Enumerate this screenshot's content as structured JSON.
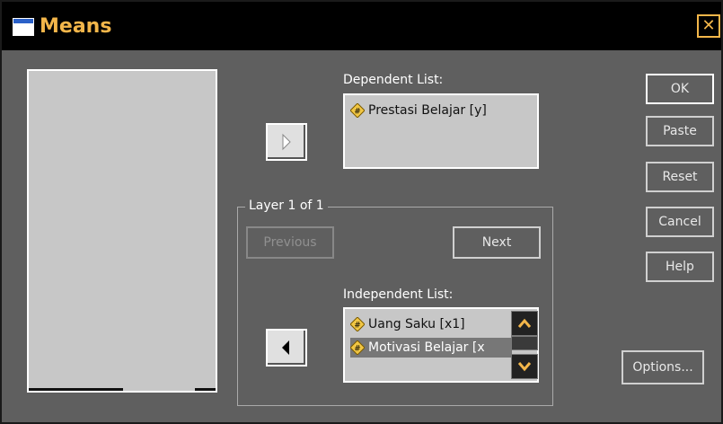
{
  "window": {
    "title": "Means"
  },
  "variables": [],
  "dependent": {
    "label": "Dependent List:",
    "items": [
      {
        "label": "Prestasi Belajar [y]",
        "icon": "scale-variable-icon"
      }
    ]
  },
  "layer": {
    "legend": "Layer 1 of 1",
    "previous_label": "Previous",
    "next_label": "Next"
  },
  "independent": {
    "label": "Independent List:",
    "items": [
      {
        "label": "Uang Saku [x1]",
        "icon": "scale-variable-icon"
      },
      {
        "label": "Motivasi Belajar [x",
        "icon": "scale-variable-icon"
      }
    ]
  },
  "buttons": {
    "ok": "OK",
    "paste": "Paste",
    "reset": "Reset",
    "cancel": "Cancel",
    "help": "Help",
    "options": "Options..."
  },
  "colors": {
    "title": "#f3b64a",
    "background": "#5f5f5f",
    "list": "#c7c7c7"
  }
}
